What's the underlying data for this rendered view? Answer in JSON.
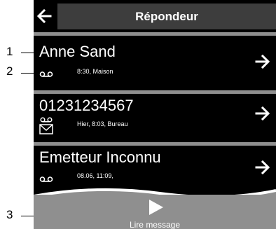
{
  "header": {
    "title": "Répondeur",
    "back_icon": "arrow-left-icon"
  },
  "messages": [
    {
      "caller": "Anne Sand",
      "details": "8:30, Maison",
      "status_icon": "voicemail-icon",
      "arrow_icon": "arrow-right-icon"
    },
    {
      "caller": "01231234567",
      "details": "Hier, 8:03, Bureau",
      "status_icon": "new-voicemail-icon",
      "arrow_icon": "arrow-right-icon"
    },
    {
      "caller": "Emetteur Inconnu",
      "details": "08.06, 11:09,",
      "status_icon": "voicemail-icon",
      "arrow_icon": "arrow-right-icon"
    }
  ],
  "play": {
    "label": "Lire message",
    "icon": "play-icon"
  },
  "callouts": [
    "1",
    "2",
    "3"
  ],
  "colors": {
    "background": "#000000",
    "title_bar": "#3d3d3d",
    "separator": "#8e8e8e",
    "play_area": "#8f8f8f",
    "text": "#ffffff"
  }
}
